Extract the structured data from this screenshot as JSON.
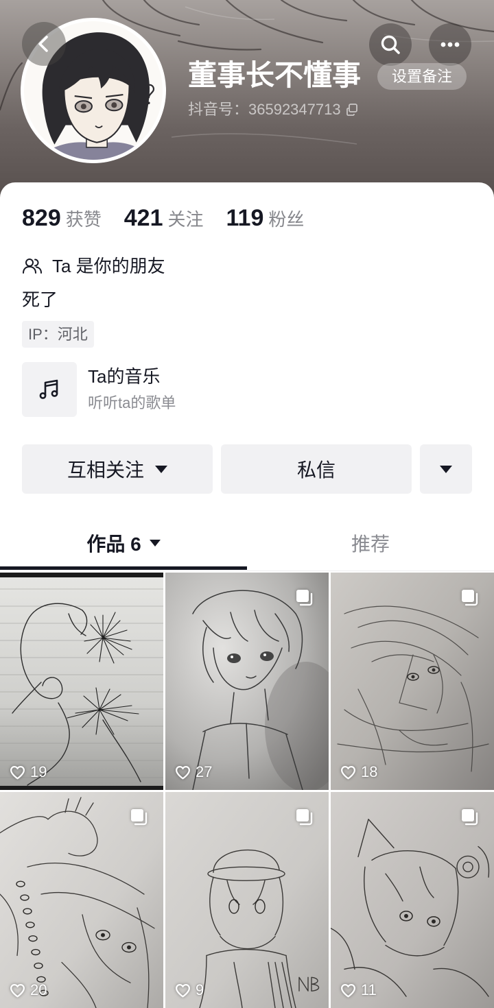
{
  "header": {
    "profile_name": "董事长不懂事",
    "remark_button": "设置备注",
    "douyin_id": "抖音号：36592347713"
  },
  "stats": [
    {
      "value": "829",
      "label": "获赞"
    },
    {
      "value": "421",
      "label": "关注"
    },
    {
      "value": "119",
      "label": "粉丝"
    }
  ],
  "friend_status": "Ta 是你的朋友",
  "bio": "死了",
  "ip_location": "IP：河北",
  "music": {
    "title": "Ta的音乐",
    "subtitle": "听听ta的歌单"
  },
  "actions": {
    "follow": "互相关注",
    "message": "私信"
  },
  "tabs": [
    {
      "label": "作品 6",
      "active": true
    },
    {
      "label": "推荐",
      "active": false
    }
  ],
  "posts": [
    {
      "likes": "19",
      "multi_image": false
    },
    {
      "likes": "27",
      "multi_image": true
    },
    {
      "likes": "18",
      "multi_image": true
    },
    {
      "likes": "20",
      "multi_image": true
    },
    {
      "likes": "9",
      "multi_image": true
    },
    {
      "likes": "11",
      "multi_image": true
    }
  ],
  "icons": {
    "back": "chevron-left-icon",
    "search": "search-icon",
    "more": "more-dots-icon",
    "copy": "copy-icon",
    "friends": "friends-icon",
    "music": "music-note-icon",
    "dropdown": "triangle-down-icon",
    "multi_image": "multi-image-icon",
    "likes": "heart-icon"
  },
  "colors": {
    "text_primary": "#161823",
    "text_secondary": "#8a8b91",
    "button_background": "#f1f1f3",
    "tab_indicator": "#161823",
    "header_background": "#6b6361"
  }
}
